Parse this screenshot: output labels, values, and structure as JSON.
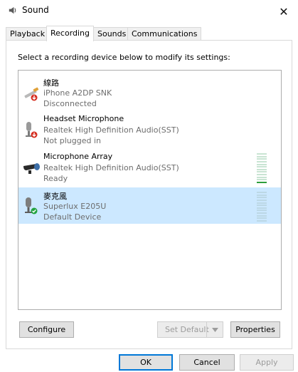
{
  "window": {
    "title": "Sound",
    "close_glyph": "✕"
  },
  "tabs": [
    {
      "label": "Playback"
    },
    {
      "label": "Recording",
      "active": true
    },
    {
      "label": "Sounds"
    },
    {
      "label": "Communications"
    }
  ],
  "instruction": "Select a recording device below to modify its settings:",
  "devices": [
    {
      "name": "線路",
      "line2": "iPhone A2DP SNK",
      "status": "Disconnected",
      "icon": "line-in-icon",
      "badge": "red-down-arrow"
    },
    {
      "name": "Headset Microphone",
      "line2": "Realtek High Definition Audio(SST)",
      "status": "Not plugged in",
      "icon": "headset-microphone-icon",
      "badge": "red-down-arrow"
    },
    {
      "name": "Microphone Array",
      "line2": "Realtek High Definition Audio(SST)",
      "status": "Ready",
      "icon": "microphone-array-icon",
      "level": 0.08
    },
    {
      "name": "麥克風",
      "line2": "Superlux E205U",
      "status": "Default Device",
      "icon": "microphone-icon",
      "badge": "green-check",
      "selected": true,
      "level": 0
    }
  ],
  "buttons": {
    "configure": "Configure",
    "set_default": "Set Default",
    "properties": "Properties",
    "ok": "OK",
    "cancel": "Cancel",
    "apply": "Apply"
  },
  "colors": {
    "selection": "#cce8ff",
    "accent": "#0078d7",
    "meter_green": "#2e9e3d"
  }
}
